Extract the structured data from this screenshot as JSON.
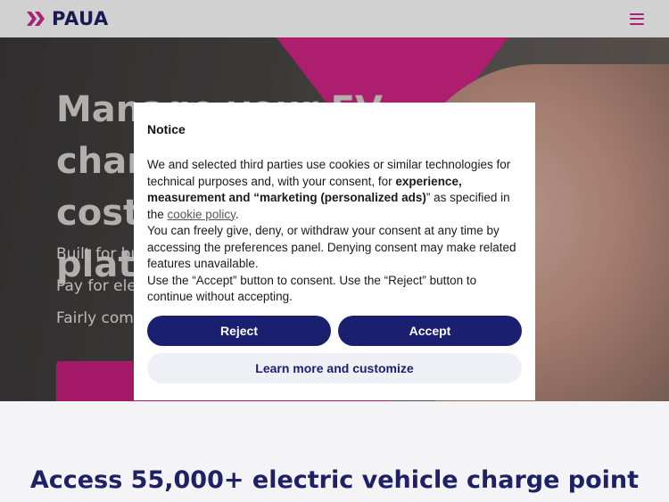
{
  "header": {
    "logo_text": "PAUA",
    "menu_icon": "hamburger-menu-icon"
  },
  "hero": {
    "title_lines": [
      "Manage your EV charging",
      "costs",
      "platf"
    ],
    "lines": [
      "Built for bu",
      "Pay for ele",
      "Fairly com"
    ]
  },
  "section": {
    "heading": "Access 55,000+ electric vehicle charge point"
  },
  "dialog": {
    "title": "Notice",
    "p1_a": "We and selected third parties use cookies or similar technologies for technical purposes and, with your consent, for ",
    "p1_bold1": "experience, measurement and “marketing (personalized ads)",
    "p1_b": "” as specified in the ",
    "p1_link": "cookie policy",
    "p1_c": ".",
    "p2": "You can freely give, deny, or withdraw your consent at any time by accessing the preferences panel. Denying consent may make related features unavailable.",
    "p3": "Use the “Accept” button to consent. Use the “Reject” button to continue without accepting.",
    "reject_label": "Reject",
    "accept_label": "Accept",
    "learn_label": "Learn more and customize"
  },
  "colors": {
    "brand_navy": "#1e2166",
    "brand_pink": "#cf2a8f",
    "button_navy": "#1a1f70"
  }
}
